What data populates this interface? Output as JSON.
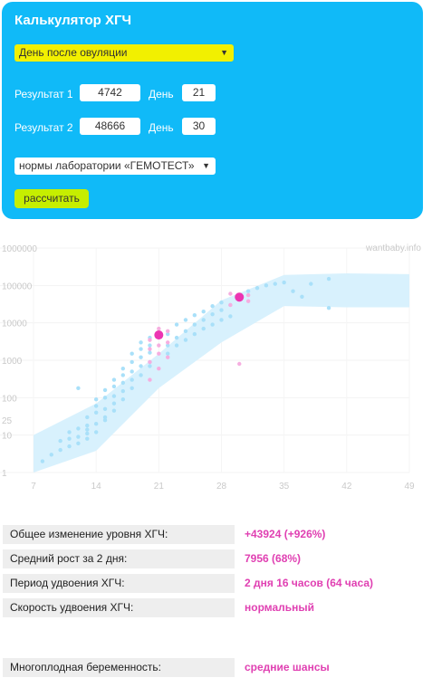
{
  "calculator": {
    "title": "Калькулятор ХГЧ",
    "mode_select": "День после овуляции",
    "result1_label": "Результат 1",
    "result1_value": "4742",
    "day1_label": "День",
    "day1_value": "21",
    "result2_label": "Результат 2",
    "result2_value": "48666",
    "day2_label": "День",
    "day2_value": "30",
    "lab_select": "нормы лаборатории «ГЕМОТЕСТ»",
    "calculate_button": "рассчитать"
  },
  "colors": {
    "panel": "#10baf8",
    "mode_select": "#f2f000",
    "button": "#c6ee00",
    "band": "#d8f1fd",
    "points_blue": "#a9e0f9",
    "points_pink": "#f6aee0",
    "result_point": "#ec35b2",
    "value_text": "#e040b2"
  },
  "chart_data": {
    "type": "scatter",
    "watermark": "wantbaby.info",
    "yscale": "log",
    "ylim": [
      1,
      1000000
    ],
    "xlim": [
      7,
      49
    ],
    "yticks": [
      "1",
      "10",
      "25",
      "100",
      "1000",
      "10000",
      "100000",
      "1000000"
    ],
    "xticks": [
      "7",
      "14",
      "21",
      "28",
      "35",
      "42",
      "49"
    ],
    "norm_band": {
      "x": [
        7,
        14,
        21,
        28,
        35,
        42,
        49
      ],
      "low": [
        1,
        3.8,
        180,
        3000,
        28000,
        26000,
        26000
      ],
      "high": [
        10,
        70,
        1500,
        40000,
        190000,
        210000,
        200000
      ]
    },
    "population_points": [
      [
        8,
        2
      ],
      [
        9,
        3
      ],
      [
        10,
        7
      ],
      [
        10,
        4
      ],
      [
        11,
        8
      ],
      [
        11,
        5
      ],
      [
        11,
        12
      ],
      [
        12,
        9
      ],
      [
        12,
        6
      ],
      [
        12,
        15
      ],
      [
        12,
        180
      ],
      [
        13,
        11
      ],
      [
        13,
        14
      ],
      [
        13,
        18
      ],
      [
        13,
        30
      ],
      [
        13,
        8
      ],
      [
        14,
        20
      ],
      [
        14,
        40
      ],
      [
        14,
        60
      ],
      [
        14,
        12
      ],
      [
        14,
        90
      ],
      [
        15,
        25
      ],
      [
        15,
        50
      ],
      [
        15,
        100
      ],
      [
        15,
        160
      ],
      [
        15,
        30
      ],
      [
        16,
        70
      ],
      [
        16,
        110
      ],
      [
        16,
        200
      ],
      [
        16,
        45
      ],
      [
        16,
        300
      ],
      [
        17,
        150
      ],
      [
        17,
        250
      ],
      [
        17,
        400
      ],
      [
        17,
        90
      ],
      [
        17,
        600
      ],
      [
        18,
        300
      ],
      [
        18,
        500
      ],
      [
        18,
        900
      ],
      [
        18,
        180
      ],
      [
        18,
        1500
      ],
      [
        19,
        700
      ],
      [
        19,
        1200
      ],
      [
        19,
        2000
      ],
      [
        19,
        400
      ],
      [
        19,
        3000
      ],
      [
        20,
        900
      ],
      [
        20,
        1600
      ],
      [
        20,
        2500
      ],
      [
        20,
        700
      ],
      [
        20,
        4000
      ],
      [
        22,
        1500
      ],
      [
        22,
        2500
      ],
      [
        22,
        5000
      ],
      [
        23,
        2500
      ],
      [
        23,
        4000
      ],
      [
        23,
        9000
      ],
      [
        24,
        3500
      ],
      [
        24,
        6000
      ],
      [
        24,
        12000
      ],
      [
        25,
        5000
      ],
      [
        25,
        9000
      ],
      [
        25,
        16000
      ],
      [
        26,
        7000
      ],
      [
        26,
        12000
      ],
      [
        26,
        20000
      ],
      [
        27,
        9000
      ],
      [
        27,
        17000
      ],
      [
        27,
        28000
      ],
      [
        28,
        12000
      ],
      [
        28,
        22000
      ],
      [
        28,
        35000
      ],
      [
        29,
        15000
      ],
      [
        29,
        30000
      ],
      [
        30,
        45000
      ],
      [
        31,
        70000
      ],
      [
        32,
        85000
      ],
      [
        33,
        100000
      ],
      [
        34,
        110000
      ],
      [
        35,
        120000
      ],
      [
        36,
        70000
      ],
      [
        37,
        50000
      ],
      [
        38,
        110000
      ],
      [
        40,
        150000
      ],
      [
        40,
        25000
      ]
    ],
    "lab_points": [
      [
        20,
        300
      ],
      [
        20,
        900
      ],
      [
        20,
        2000
      ],
      [
        20,
        3500
      ],
      [
        21,
        1500
      ],
      [
        21,
        2500
      ],
      [
        21,
        4000
      ],
      [
        21,
        7000
      ],
      [
        21,
        600
      ],
      [
        22,
        1200
      ],
      [
        22,
        3000
      ],
      [
        22,
        6000
      ],
      [
        29,
        30000
      ],
      [
        29,
        60000
      ],
      [
        30,
        800
      ],
      [
        31,
        55000
      ],
      [
        31,
        38000
      ]
    ],
    "results": [
      {
        "x": 21,
        "y": 4742
      },
      {
        "x": 30,
        "y": 48666
      }
    ]
  },
  "stats": {
    "total_change_label": "Общее изменение уровня ХГЧ:",
    "total_change_value": "+43924 (+926%)",
    "avg_growth_label": "Средний рост за 2 дня:",
    "avg_growth_value": "7956 (68%)",
    "doubling_period_label": "Период удвоения ХГЧ:",
    "doubling_period_value": "2 дня 16 часов (64 часа)",
    "doubling_speed_label": "Скорость удвоения ХГЧ:",
    "doubling_speed_value": "нормальный",
    "multiple_label": "Многоплодная беременность:",
    "multiple_value": "средние шансы"
  }
}
